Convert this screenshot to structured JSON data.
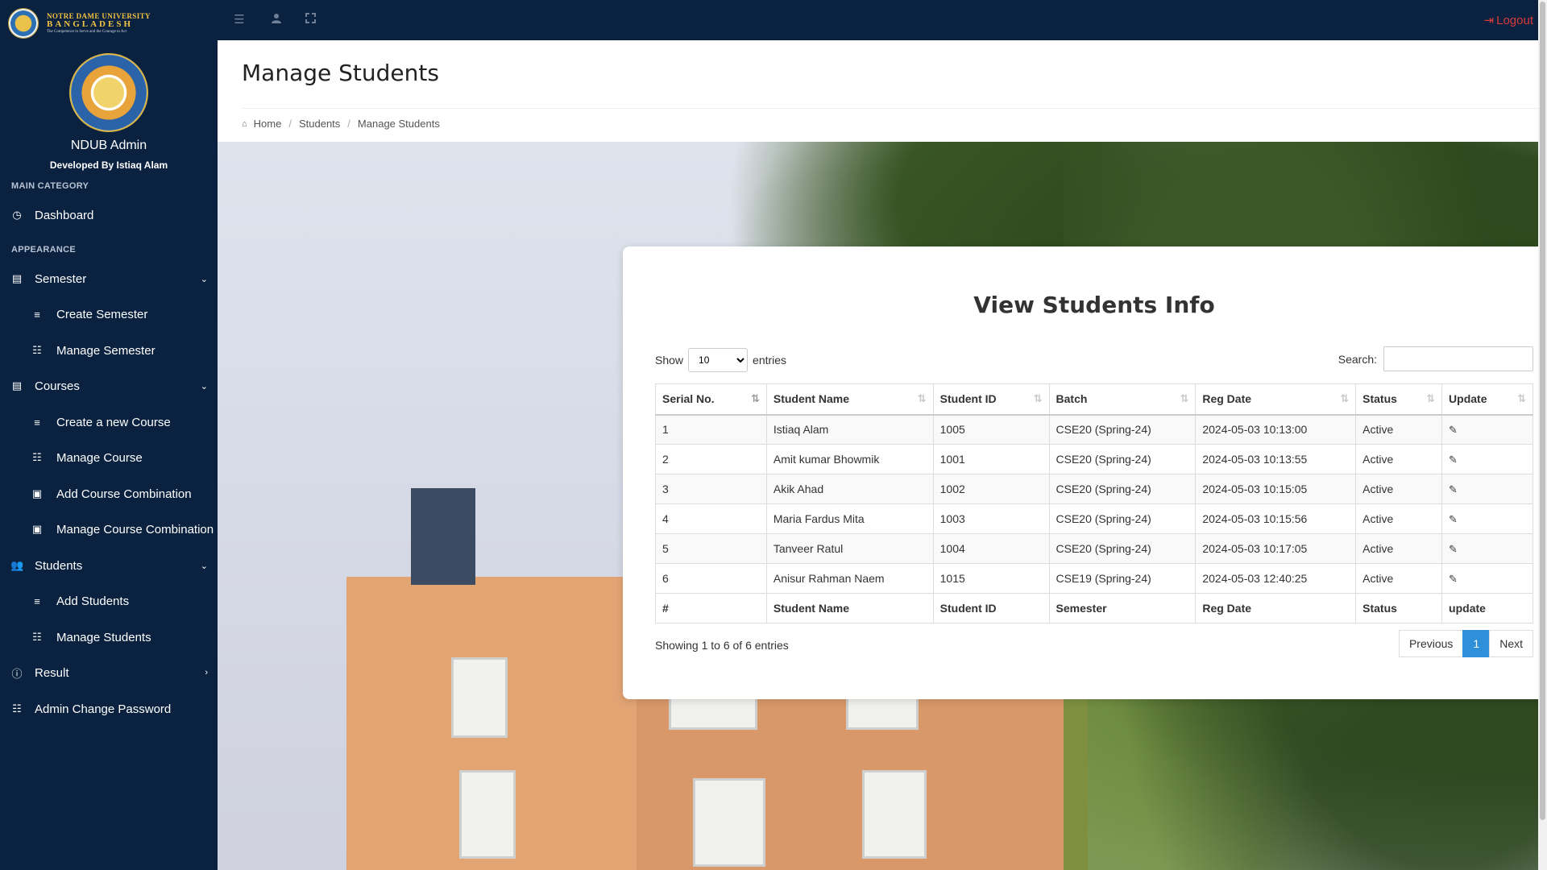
{
  "topbar": {
    "brand_line1": "NOTRE DAME UNIVERSITY",
    "brand_line2": "BANGLADESH",
    "brand_line3": "The Competence to Serve and the Courage to Act",
    "logout_label": "Logout",
    "icons": [
      "menu-toggle-icon",
      "user-icon",
      "fullscreen-icon"
    ]
  },
  "sidebar": {
    "admin_name": "NDUB Admin",
    "developer": "Developed By Istiaq Alam",
    "section_main": "MAIN CATEGORY",
    "section_appearance": "APPEARANCE",
    "items": [
      {
        "label": "Dashboard",
        "icon": "dashboard-icon"
      },
      {
        "label": "Semester",
        "icon": "file-icon"
      },
      {
        "label": "Create Semester",
        "icon": "list-icon"
      },
      {
        "label": "Manage Semester",
        "icon": "table-icon"
      },
      {
        "label": "Courses",
        "icon": "file-icon"
      },
      {
        "label": "Create a new Course",
        "icon": "list-icon"
      },
      {
        "label": "Manage Course",
        "icon": "table-icon"
      },
      {
        "label": "Add Course Combination",
        "icon": "card-icon"
      },
      {
        "label": "Manage Course Combination",
        "icon": "card-icon"
      },
      {
        "label": "Students",
        "icon": "users-icon"
      },
      {
        "label": "Add Students",
        "icon": "list-icon"
      },
      {
        "label": "Manage Students",
        "icon": "table-icon"
      },
      {
        "label": "Result",
        "icon": "info-icon"
      },
      {
        "label": "Admin Change Password",
        "icon": "table-icon"
      }
    ]
  },
  "header": {
    "title": "Manage Students",
    "breadcrumb": [
      "Home",
      "Students",
      "Manage Students"
    ]
  },
  "card": {
    "title": "View Students Info",
    "show_label": "Show",
    "entries_label": "entries",
    "page_size": "10",
    "search_label": "Search:",
    "search_value": "",
    "columns": [
      "Serial No.",
      "Student Name",
      "Student ID",
      "Batch",
      "Reg Date",
      "Status",
      "Update"
    ],
    "rows": [
      {
        "serial": "1",
        "name": "Istiaq Alam",
        "id": "1005",
        "batch": "CSE20 (Spring-24)",
        "reg_date": "2024-05-03 10:13:00",
        "status": "Active"
      },
      {
        "serial": "2",
        "name": "Amit kumar Bhowmik",
        "id": "1001",
        "batch": "CSE20 (Spring-24)",
        "reg_date": "2024-05-03 10:13:55",
        "status": "Active"
      },
      {
        "serial": "3",
        "name": "Akik Ahad",
        "id": "1002",
        "batch": "CSE20 (Spring-24)",
        "reg_date": "2024-05-03 10:15:05",
        "status": "Active"
      },
      {
        "serial": "4",
        "name": "Maria Fardus Mita",
        "id": "1003",
        "batch": "CSE20 (Spring-24)",
        "reg_date": "2024-05-03 10:15:56",
        "status": "Active"
      },
      {
        "serial": "5",
        "name": "Tanveer Ratul",
        "id": "1004",
        "batch": "CSE20 (Spring-24)",
        "reg_date": "2024-05-03 10:17:05",
        "status": "Active"
      },
      {
        "serial": "6",
        "name": "Anisur Rahman Naem",
        "id": "1015",
        "batch": "CSE19 (Spring-24)",
        "reg_date": "2024-05-03 12:40:25",
        "status": "Active"
      }
    ],
    "footer_columns": [
      "#",
      "Student Name",
      "Student ID",
      "Semester",
      "Reg Date",
      "Status",
      "update"
    ],
    "info": "Showing 1 to 6 of 6 entries",
    "pager": {
      "previous": "Previous",
      "current": "1",
      "next": "Next"
    }
  },
  "colors": {
    "navy": "#0a2240",
    "accent_blue": "#2f8fd8",
    "logout_red": "#d93a3a"
  }
}
